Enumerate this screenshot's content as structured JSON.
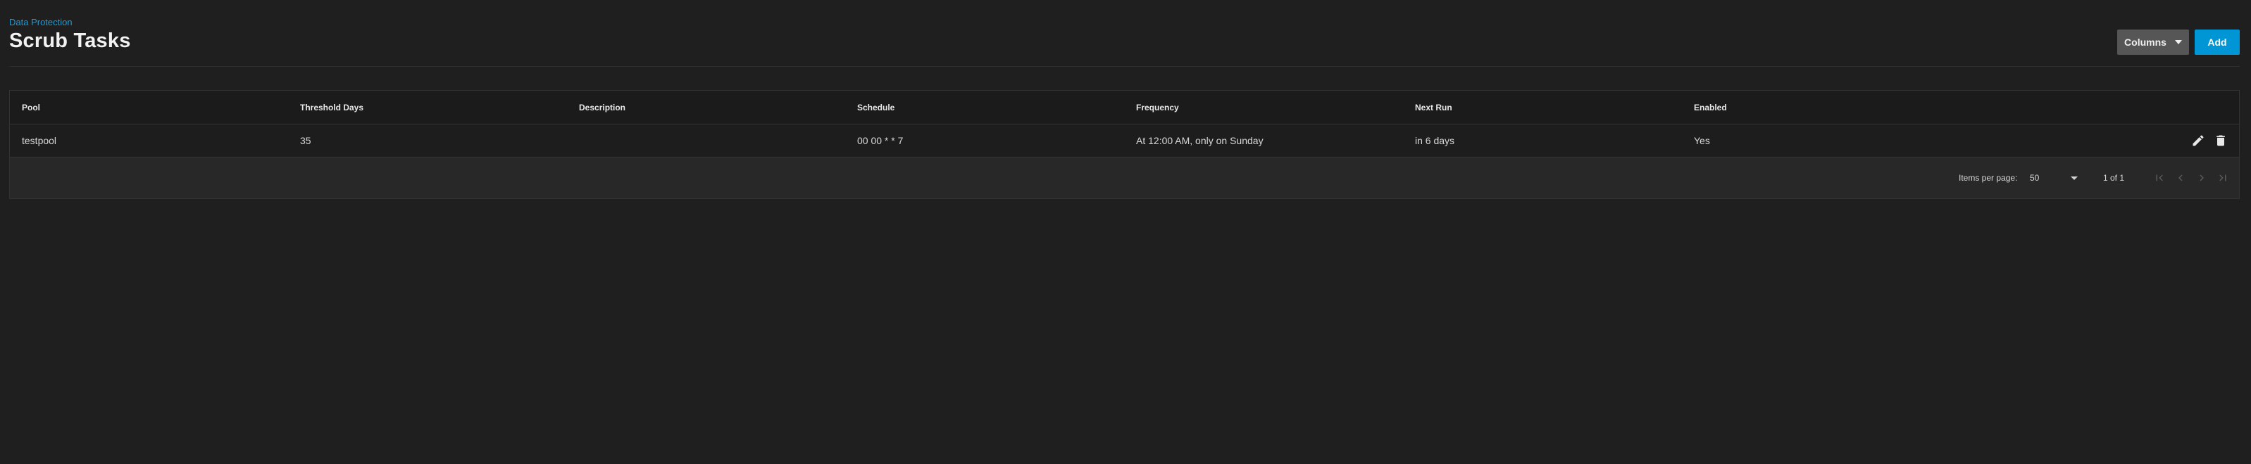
{
  "header": {
    "breadcrumb": "Data Protection",
    "title": "Scrub Tasks",
    "columns_button": "Columns",
    "add_button": "Add"
  },
  "table": {
    "columns": [
      "Pool",
      "Threshold Days",
      "Description",
      "Schedule",
      "Frequency",
      "Next Run",
      "Enabled"
    ],
    "rows": [
      {
        "pool": "testpool",
        "threshold_days": "35",
        "description": "",
        "schedule": "00 00 * * 7",
        "frequency": "At 12:00 AM, only on Sunday",
        "next_run": "in 6 days",
        "enabled": "Yes"
      }
    ]
  },
  "paginator": {
    "items_per_page_label": "Items per page:",
    "items_per_page_value": "50",
    "range_label": "1 of 1"
  },
  "icons": {
    "edit": "pencil-icon",
    "delete": "trash-icon",
    "first_page": "first-page-icon",
    "previous_page": "chevron-left-icon",
    "next_page": "chevron-right-icon",
    "last_page": "last-page-icon"
  },
  "colors": {
    "background": "#1f1f1f",
    "accent": "#0095d5",
    "breadcrumb_link": "#1e9bd7",
    "secondary_button": "#565656"
  }
}
